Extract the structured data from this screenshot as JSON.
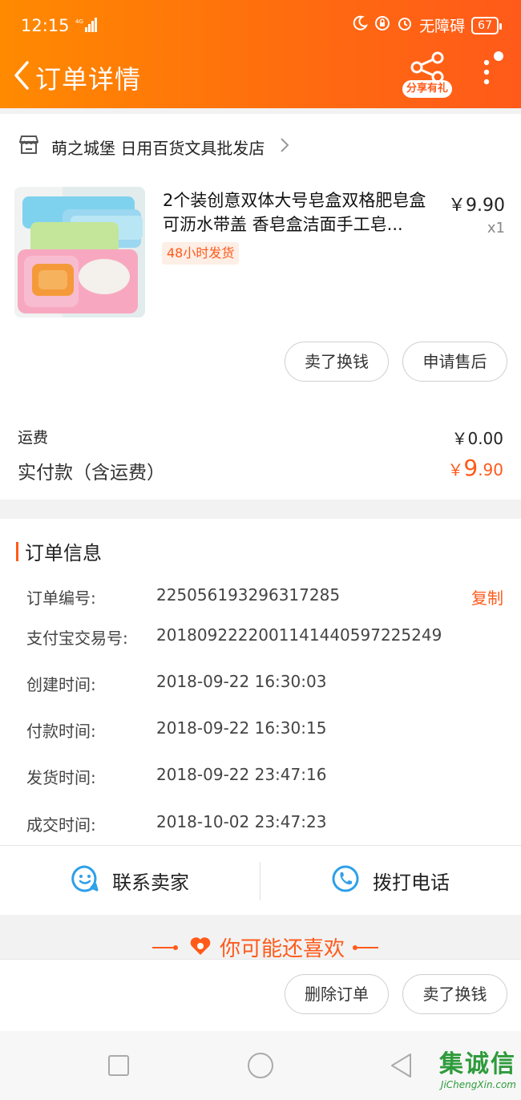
{
  "status_bar": {
    "time": "12:15",
    "network": "4G",
    "accessibility_text": "无障碍",
    "battery": "67"
  },
  "header": {
    "title": "订单详情",
    "share_badge": "分享有礼"
  },
  "shop": {
    "name": "萌之城堡 日用百货文具批发店"
  },
  "product": {
    "title": "2个装创意双体大号皂盒双格肥皂盒可沥水带盖 香皂盒洁面手工皂...",
    "tag": "48小时发货",
    "price": "￥9.90",
    "quantity": "x1"
  },
  "item_actions": {
    "sell_for_cash": "卖了换钱",
    "after_sales": "申请售后"
  },
  "summary": {
    "shipping_label": "运费",
    "shipping_value": "￥0.00",
    "paid_label": "实付款（含运费）",
    "paid_symbol": "￥",
    "paid_int": "9",
    "paid_dec": ".90"
  },
  "order_info": {
    "section_title": "订单信息",
    "copy_label": "复制",
    "rows": [
      {
        "label": "订单编号:",
        "value": "225056193296317285"
      },
      {
        "label": "支付宝交易号:",
        "value": "2018092222001141440597225249"
      },
      {
        "label": "创建时间:",
        "value": "2018-09-22 16:30:03"
      },
      {
        "label": "付款时间:",
        "value": "2018-09-22 16:30:15"
      },
      {
        "label": "发货时间:",
        "value": "2018-09-22 23:47:16"
      },
      {
        "label": "成交时间:",
        "value": "2018-10-02 23:47:23"
      }
    ]
  },
  "contact": {
    "seller": "联系卖家",
    "call": "拨打电话"
  },
  "recommend": {
    "title": "你可能还喜欢"
  },
  "bottom_actions": {
    "delete_order": "删除订单",
    "sell_for_cash": "卖了换钱"
  },
  "watermark": {
    "main": "集诚信",
    "sub": "JiChengXin.com"
  },
  "colors": {
    "accent": "#ff5a1a",
    "header_start": "#ff8a00",
    "header_end": "#ff5a1a"
  }
}
